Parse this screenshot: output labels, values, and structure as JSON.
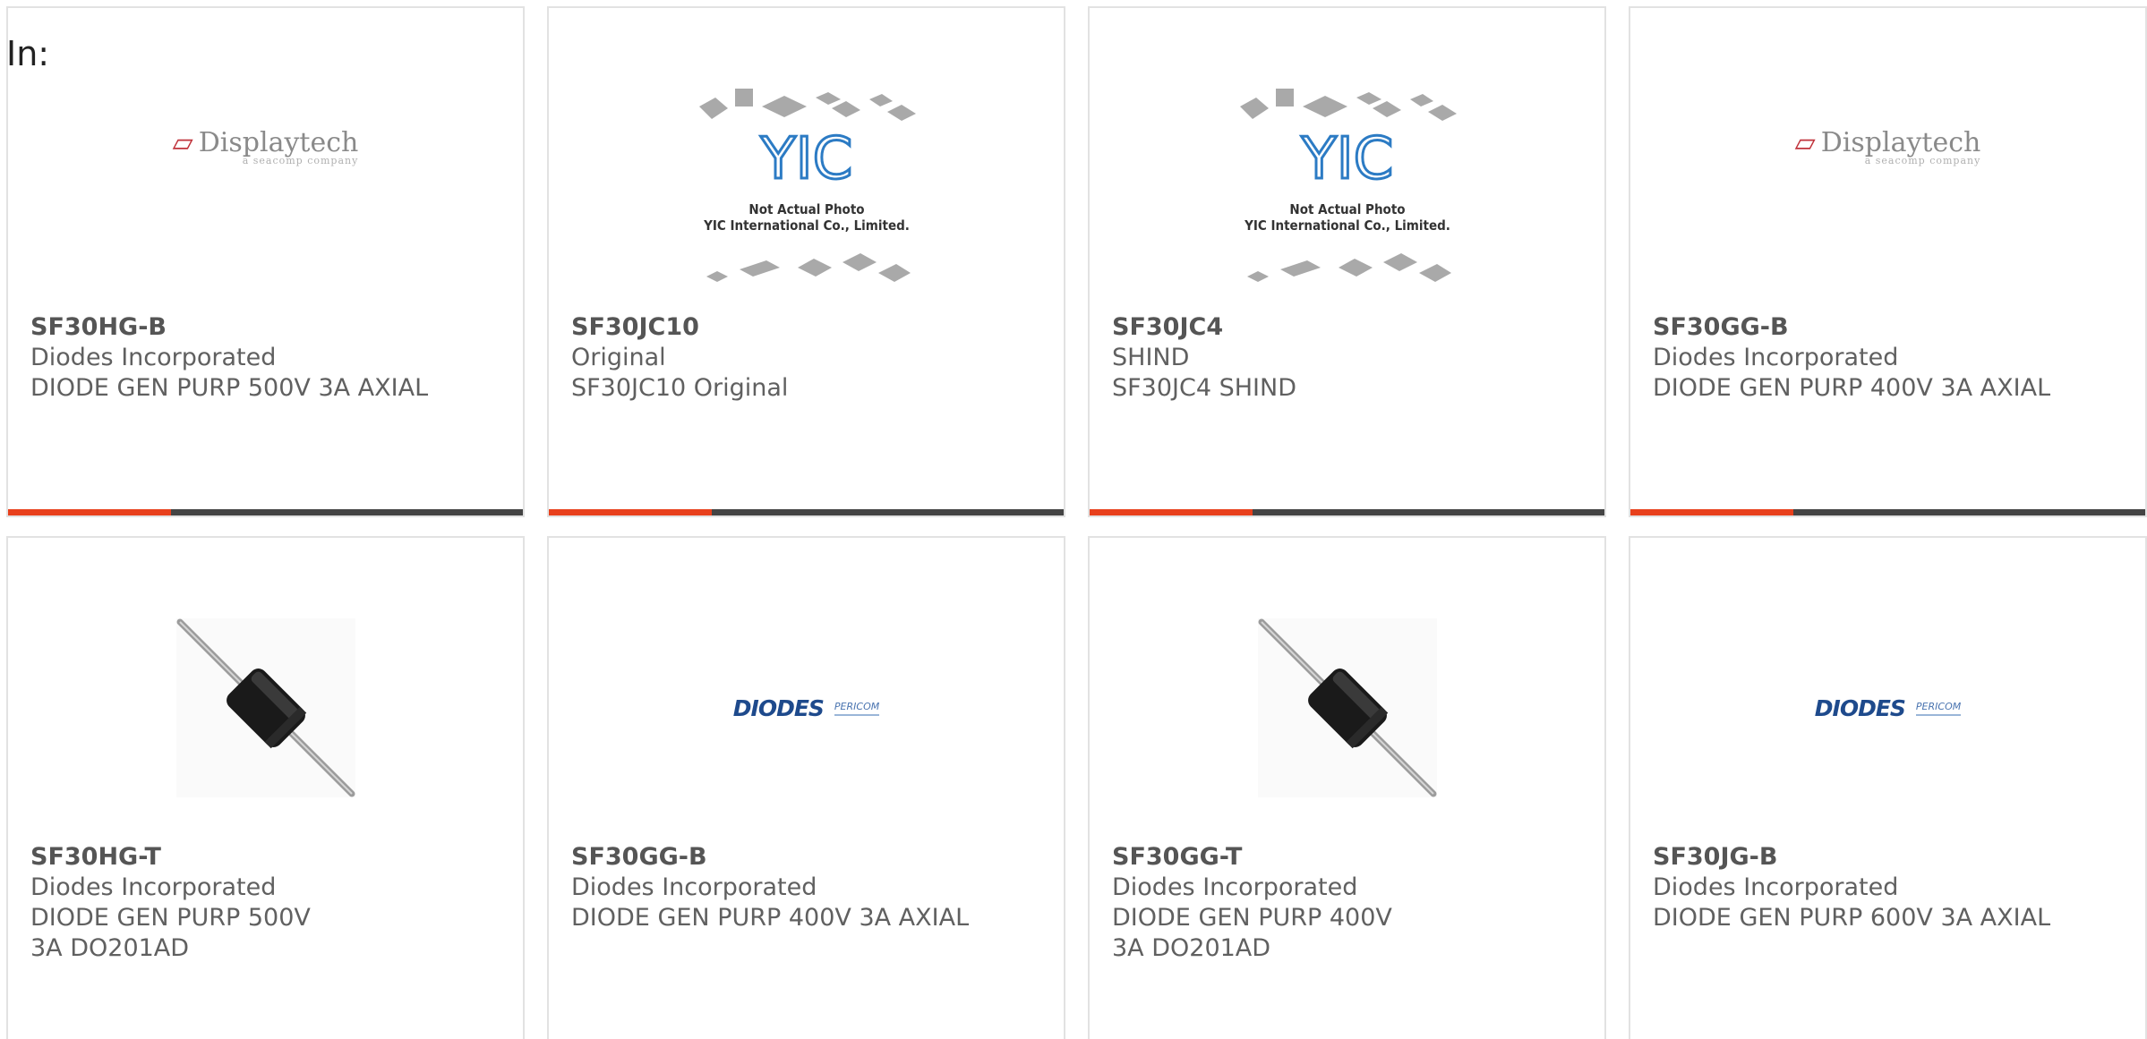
{
  "header": {
    "in_label": "In:"
  },
  "colors": {
    "accent": "#e8401c",
    "bar": "#444444",
    "border": "#e2e2e2"
  },
  "cards": [
    {
      "part": "SF30HG-B",
      "manufacturer": "Diodes Incorporated",
      "description": "DIODE GEN PURP 500V 3A AXIAL",
      "image": "displaytech-logo",
      "image_text": "Displaytech",
      "image_subtext": "a seacomp company"
    },
    {
      "part": "SF30JC10",
      "manufacturer": "Original",
      "description": "SF30JC10 Original",
      "image": "yic-placeholder",
      "image_text": "Not Actual Photo",
      "image_subtext": "YIC International Co., Limited."
    },
    {
      "part": "SF30JC4",
      "manufacturer": "SHIND",
      "description": "SF30JC4 SHIND",
      "image": "yic-placeholder",
      "image_text": "Not Actual Photo",
      "image_subtext": "YIC International Co., Limited."
    },
    {
      "part": "SF30GG-B",
      "manufacturer": "Diodes Incorporated",
      "description": "DIODE GEN PURP 400V 3A AXIAL",
      "image": "displaytech-logo",
      "image_text": "Displaytech",
      "image_subtext": "a seacomp company"
    },
    {
      "part": "SF30HG-T",
      "manufacturer": "Diodes Incorporated",
      "description": "DIODE GEN PURP 500V 3A DO201AD",
      "image": "axial-diode-photo"
    },
    {
      "part": "SF30GG-B",
      "manufacturer": "Diodes Incorporated",
      "description": "DIODE GEN PURP 400V 3A AXIAL",
      "image": "diodes-pericom-logo",
      "image_text": "DIODES",
      "image_subtext": "PERICOM"
    },
    {
      "part": "SF30GG-T",
      "manufacturer": "Diodes Incorporated",
      "description": "DIODE GEN PURP 400V 3A DO201AD",
      "image": "axial-diode-photo"
    },
    {
      "part": "SF30JG-B",
      "manufacturer": "Diodes Incorporated",
      "description": "DIODE GEN PURP 600V 3A AXIAL",
      "image": "diodes-pericom-logo",
      "image_text": "DIODES",
      "image_subtext": "PERICOM"
    }
  ]
}
